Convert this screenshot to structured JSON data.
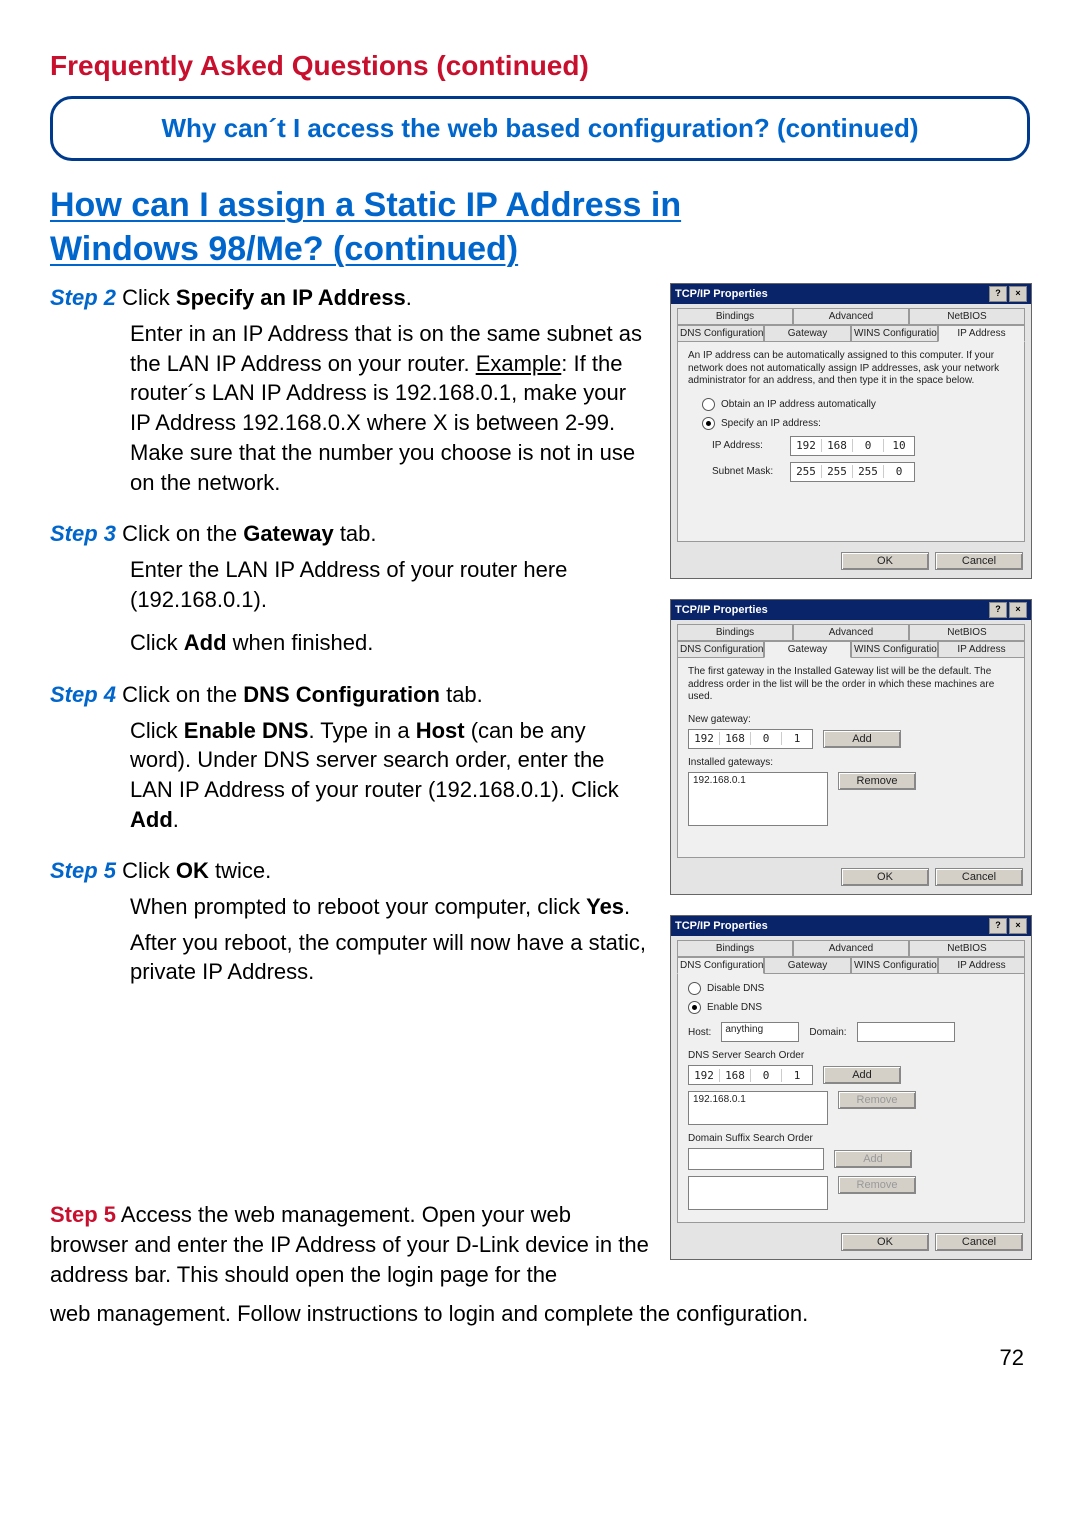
{
  "page": {
    "number": "72",
    "faq_title": "Frequently Asked Questions (continued)",
    "banner": "Why can´t I access the web based configuration? (continued)",
    "howto_line1": "How can I assign a Static IP Address in",
    "howto_line2": "Windows 98/Me? (continued)"
  },
  "steps": {
    "s2": {
      "label": "Step 2",
      "title_prefix": " Click ",
      "title_bold": "Specify an IP Address",
      "title_suffix": ".",
      "body_a": "Enter in an IP Address that is on the same subnet as the LAN IP Address on your router. ",
      "body_ex_label": "Example",
      "body_b": ": If the router´s LAN IP Address is 192.168.0.1, make your IP Address 192.168.0.X where X is between 2-99. Make sure that the number you choose is not in use on the network."
    },
    "s3": {
      "label": "Step 3",
      "title_prefix": " Click on the ",
      "title_bold": "Gateway",
      "title_suffix": " tab.",
      "body_a": "Enter the LAN IP Address of your router here (192.168.0.1).",
      "body_b1": "Click ",
      "body_b_bold": "Add",
      "body_b2": " when finished."
    },
    "s4": {
      "label": "Step 4",
      "title_prefix": " Click on the ",
      "title_bold": "DNS Configuration",
      "title_suffix": " tab.",
      "body_1": "Click ",
      "body_bold1": "Enable DNS",
      "body_2": ". Type in a ",
      "body_bold2": "Host",
      "body_3": " (can be any word). Under DNS server search order, enter the LAN IP Address of your router (192.168.0.1). Click ",
      "body_bold3": "Add",
      "body_4": "."
    },
    "s5i": {
      "label": "Step 5",
      "title_prefix": " Click ",
      "title_bold": "OK",
      "title_suffix": " twice.",
      "body_a1": "When prompted to reboot your computer, click ",
      "body_a_bold": "Yes",
      "body_a2": ".",
      "body_b": "After you reboot, the computer will now have a static, private IP Address."
    },
    "s5r": {
      "label": "Step 5",
      "body_a": " Access the web management. Open your web browser and enter the IP Address of your D-Link device in the address bar. This should open the login page for the",
      "body_b": "web management. Follow instructions to login and complete the configuration."
    }
  },
  "dialogs": {
    "title": "TCP/IP Properties",
    "help_btn": "?",
    "close_btn": "×",
    "ok": "OK",
    "cancel": "Cancel",
    "add": "Add",
    "remove": "Remove",
    "tabs_top": [
      "Bindings",
      "Advanced",
      "NetBIOS"
    ],
    "tabs_bottom": [
      "DNS Configuration",
      "Gateway",
      "WINS Configuration",
      "IP Address"
    ],
    "d1": {
      "active_tab": "IP Address",
      "desc": "An IP address can be automatically assigned to this computer. If your network does not automatically assign IP addresses, ask your network administrator for an address, and then type it in the space below.",
      "radio_auto": "Obtain an IP address automatically",
      "radio_spec": "Specify an IP address:",
      "ip_label": "IP Address:",
      "ip_value": [
        "192",
        "168",
        "0",
        "10"
      ],
      "mask_label": "Subnet Mask:",
      "mask_value": [
        "255",
        "255",
        "255",
        "0"
      ]
    },
    "d2": {
      "active_tab": "Gateway",
      "desc": "The first gateway in the Installed Gateway list will be the default. The address order in the list will be the order in which these machines are used.",
      "new_gw_label": "New gateway:",
      "new_gw_value": [
        "192",
        "168",
        "0",
        "1"
      ],
      "installed_label": "Installed gateways:",
      "installed_item": "192.168.0.1"
    },
    "d3": {
      "active_tab": "DNS Configuration",
      "radio_disable": "Disable DNS",
      "radio_enable": "Enable DNS",
      "host_label": "Host:",
      "host_value": "anything",
      "domain_label": "Domain:",
      "domain_value": "",
      "search_label": "DNS Server Search Order",
      "search_value": [
        "192",
        "168",
        "0",
        "1"
      ],
      "search_item": "192.168.0.1",
      "suffix_label": "Domain Suffix Search Order"
    }
  }
}
